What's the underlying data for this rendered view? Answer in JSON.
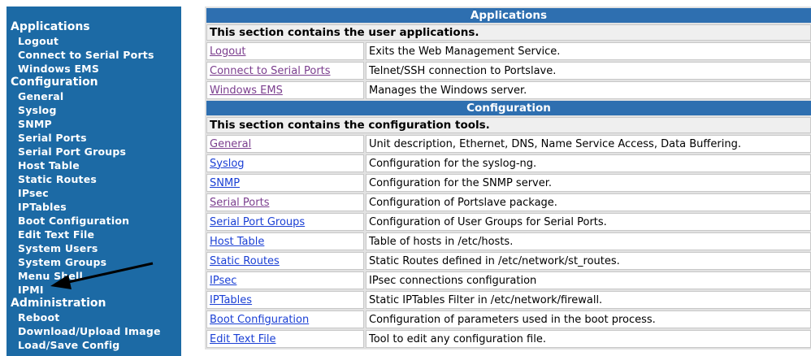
{
  "sidebar": {
    "sections": [
      {
        "title": "Applications",
        "items": [
          "Logout",
          "Connect to Serial Ports",
          "Windows EMS"
        ]
      },
      {
        "title": "Configuration",
        "items": [
          "General",
          "Syslog",
          "SNMP",
          "Serial Ports",
          "Serial Port Groups",
          "Host Table",
          "Static Routes",
          "IPsec",
          "IPTables",
          "Boot Configuration",
          "Edit Text File",
          "System Users",
          "System Groups",
          "Menu Shell",
          "IPMI"
        ]
      },
      {
        "title": "Administration",
        "items": [
          "Reboot",
          "Download/Upload Image",
          "Load/Save Config"
        ]
      }
    ]
  },
  "main": {
    "applications": {
      "header": "Applications",
      "intro": "This section contains the user applications.",
      "rows": [
        {
          "link": "Logout",
          "desc": "Exits the Web Management Service.",
          "visited": true
        },
        {
          "link": "Connect to Serial Ports",
          "desc": "Telnet/SSH connection to Portslave.",
          "visited": true
        },
        {
          "link": "Windows EMS",
          "desc": "Manages the Windows server.",
          "visited": true
        }
      ]
    },
    "configuration": {
      "header": "Configuration",
      "intro": "This section contains the configuration tools.",
      "rows": [
        {
          "link": "General",
          "desc": "Unit description, Ethernet, DNS, Name Service Access, Data Buffering.",
          "visited": true
        },
        {
          "link": "Syslog",
          "desc": "Configuration for the syslog-ng.",
          "visited": false
        },
        {
          "link": "SNMP",
          "desc": "Configuration for the SNMP server.",
          "visited": false
        },
        {
          "link": "Serial Ports",
          "desc": "Configuration of Portslave package.",
          "visited": true
        },
        {
          "link": "Serial Port Groups",
          "desc": "Configuration of User Groups for Serial Ports.",
          "visited": false
        },
        {
          "link": "Host Table",
          "desc": "Table of hosts in /etc/hosts.",
          "visited": false
        },
        {
          "link": "Static Routes",
          "desc": "Static Routes defined in /etc/network/st_routes.",
          "visited": false
        },
        {
          "link": "IPsec",
          "desc": "IPsec connections configuration",
          "visited": false
        },
        {
          "link": "IPTables",
          "desc": "Static IPTables Filter in /etc/network/firewall.",
          "visited": false
        },
        {
          "link": "Boot Configuration",
          "desc": "Configuration of parameters used in the boot process.",
          "visited": false
        },
        {
          "link": "Edit Text File",
          "desc": "Tool to edit any configuration file.",
          "visited": false
        }
      ]
    }
  },
  "colors": {
    "sidebar_bg": "#1c6aa5",
    "header_bg": "#2e6fb0",
    "visited_link": "#7b3e8e",
    "link": "#1a3fd4"
  },
  "annotation": {
    "icon": "arrow-icon",
    "points_to": "IPMI"
  }
}
